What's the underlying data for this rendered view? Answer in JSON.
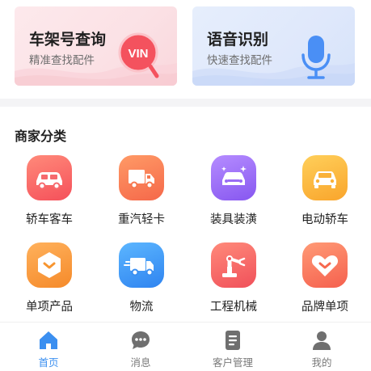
{
  "banners": {
    "vin": {
      "title": "车架号查询",
      "subtitle": "精准查找配件",
      "badge_text": "VIN"
    },
    "voice": {
      "title": "语音识别",
      "subtitle": "快速查找配件"
    }
  },
  "section": {
    "title": "商家分类"
  },
  "categories": [
    {
      "label": "轿车客车",
      "icon": "sedan-icon"
    },
    {
      "label": "重汽轻卡",
      "icon": "truck-icon"
    },
    {
      "label": "装具装潢",
      "icon": "car-decor-icon"
    },
    {
      "label": "电动轿车",
      "icon": "electric-car-icon"
    },
    {
      "label": "单项产品",
      "icon": "product-icon"
    },
    {
      "label": "物流",
      "icon": "delivery-truck-icon"
    },
    {
      "label": "工程机械",
      "icon": "robot-arm-icon"
    },
    {
      "label": "品牌单项",
      "icon": "brand-heart-icon"
    }
  ],
  "tabbar": {
    "items": [
      {
        "label": "首页",
        "icon": "home-icon",
        "active": true
      },
      {
        "label": "消息",
        "icon": "message-icon",
        "active": false
      },
      {
        "label": "客户管理",
        "icon": "customer-doc-icon",
        "active": false
      },
      {
        "label": "我的",
        "icon": "user-icon",
        "active": false
      }
    ]
  },
  "colors": {
    "accent": "#3b8ff0",
    "vin_red": "#f4525e",
    "mic_blue": "#4a8ff5"
  }
}
